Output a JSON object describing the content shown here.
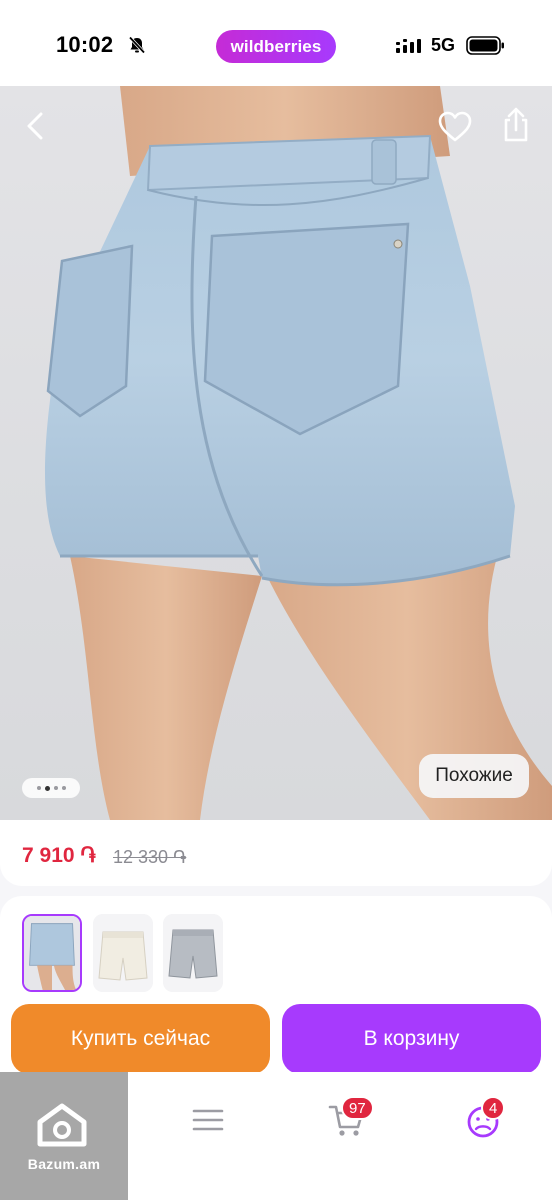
{
  "status_bar": {
    "time": "10:02",
    "brand": "wildberries",
    "network": "5G"
  },
  "gallery": {
    "similar_label": "Похожие",
    "image_count": 4,
    "active_index": 2
  },
  "price": {
    "current": "7 910 ֏",
    "old": "12 330 ֏"
  },
  "actions": {
    "buy_now": "Купить сейчас",
    "add_to_cart": "В корзину"
  },
  "bottom_nav": {
    "cart_count": "97",
    "profile_count": "4",
    "watermark": "Bazum.am"
  },
  "colors": {
    "accent": "#a73afd",
    "buy_now": "#f08a2a",
    "price": "#e0263f",
    "badge": "#e0263f"
  }
}
